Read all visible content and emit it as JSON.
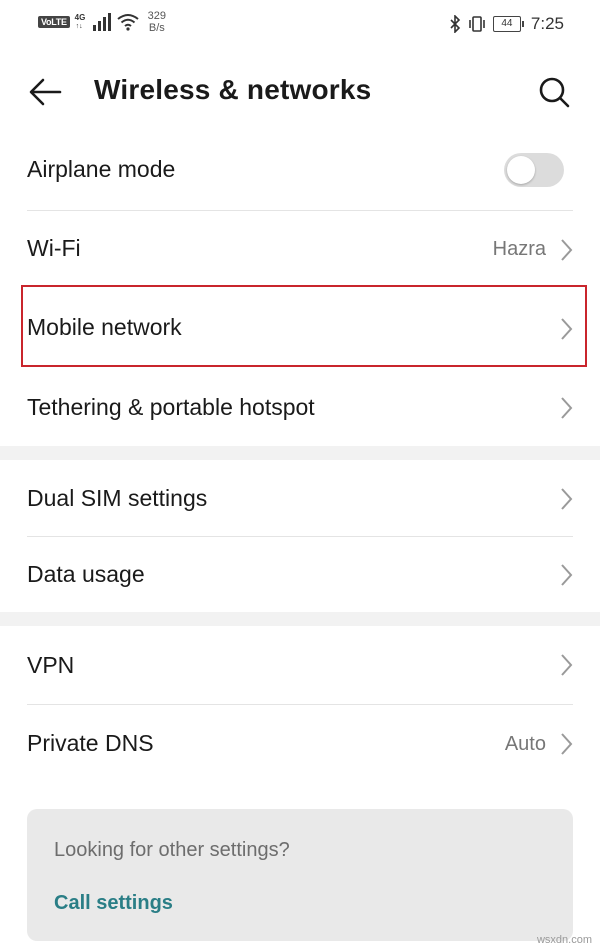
{
  "status_bar": {
    "volte": "VoLTE",
    "network_type": "4G",
    "speed_value": "329",
    "speed_unit": "B/s",
    "battery": "44",
    "time": "7:25"
  },
  "header": {
    "title": "Wireless & networks"
  },
  "sections": [
    {
      "items": [
        {
          "label": "Airplane mode",
          "type": "toggle",
          "on": false
        },
        {
          "label": "Wi-Fi",
          "value": "Hazra"
        },
        {
          "label": "Mobile network",
          "highlighted": true
        },
        {
          "label": "Tethering & portable hotspot"
        }
      ]
    },
    {
      "items": [
        {
          "label": "Dual SIM settings"
        },
        {
          "label": "Data usage"
        }
      ]
    },
    {
      "items": [
        {
          "label": "VPN"
        },
        {
          "label": "Private DNS",
          "value": "Auto"
        }
      ]
    }
  ],
  "suggestion": {
    "prompt": "Looking for other settings?",
    "link": "Call settings"
  },
  "colors": {
    "highlight": "#c9252c",
    "link": "#2a7e86",
    "toggle_off": "#dcdcdc"
  },
  "watermark": "wsxdn.com"
}
